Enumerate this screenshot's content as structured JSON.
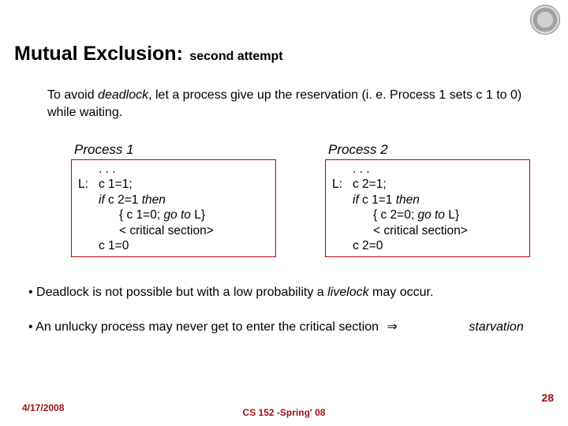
{
  "title": {
    "main": "Mutual Exclusion:",
    "sub": "second attempt"
  },
  "intro": {
    "pre": "To avoid ",
    "deadlock": "deadlock",
    "post": ", let a process give up the reservation (i. e. Process 1 sets c 1 to 0) while waiting."
  },
  "procs": [
    {
      "heading": "Process 1",
      "lines": {
        "dots": ". . .",
        "label": "L:",
        "l1": "c 1=1;",
        "l2a": "if",
        "l2b": " c 2=1 ",
        "l2c": "then",
        "l3a": "{ c 1=0; ",
        "l3b": "go to",
        "l3c": " L}",
        "l4": "< critical section>",
        "l5": "c 1=0"
      }
    },
    {
      "heading": "Process 2",
      "lines": {
        "dots": ". . .",
        "label": "L:",
        "l1": "c 2=1;",
        "l2a": "if",
        "l2b": " c 1=1 ",
        "l2c": "then",
        "l3a": "{ c 2=0; ",
        "l3b": "go to",
        "l3c": " L}",
        "l4": "< critical section>",
        "l5": "c 2=0"
      }
    }
  ],
  "bullets": {
    "b1a": "• Deadlock is not possible but with a low probability a ",
    "b1live": "livelock",
    "b1b": " may occur.",
    "b2a": "• An unlucky process may never get to enter the critical section",
    "arrow": "⇒",
    "starv": "starvation"
  },
  "footer": {
    "date": "4/17/2008",
    "mid": "CS 152 -Spring' 08",
    "num": "28"
  }
}
